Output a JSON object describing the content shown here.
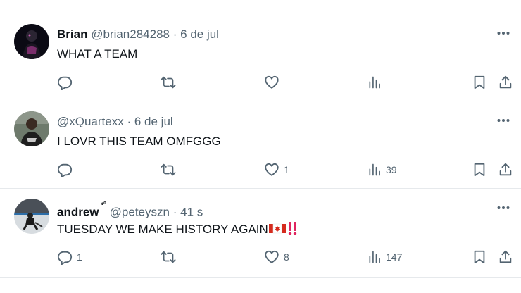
{
  "posts": [
    {
      "display_name": "Brian",
      "badge": "",
      "handle": "@brian284288",
      "separator": "·",
      "time": "6 de jul",
      "text": "WHAT A TEAM",
      "emoji": "",
      "replies": "",
      "reposts": "",
      "likes": "",
      "views": ""
    },
    {
      "display_name": "",
      "badge": "",
      "handle": "@xQuartexx",
      "separator": "·",
      "time": "6 de jul",
      "text": "I LOVR THIS TEAM OMFGGG",
      "emoji": "",
      "replies": "",
      "reposts": "",
      "likes": "1",
      "views": "39"
    },
    {
      "display_name": "andrew",
      "badge": "⁴⁰",
      "handle": "@peteyszn",
      "separator": "·",
      "time": "41 s",
      "text": "TUESDAY WE MAKE HISTORY AGAIN",
      "emoji": "🇨🇦‼️",
      "replies": "1",
      "reposts": "",
      "likes": "8",
      "views": "147"
    }
  ],
  "icons": {
    "more": "more-icon",
    "reply": "reply-icon",
    "repost": "repost-icon",
    "like": "heart-icon",
    "views": "views-icon",
    "bookmark": "bookmark-icon",
    "share": "share-icon"
  },
  "colors": {
    "text": "#0f1419",
    "muted": "#536471",
    "divider": "#e6e9ec",
    "exclamation": "#e0245e",
    "flag_red": "#d52b1e"
  }
}
